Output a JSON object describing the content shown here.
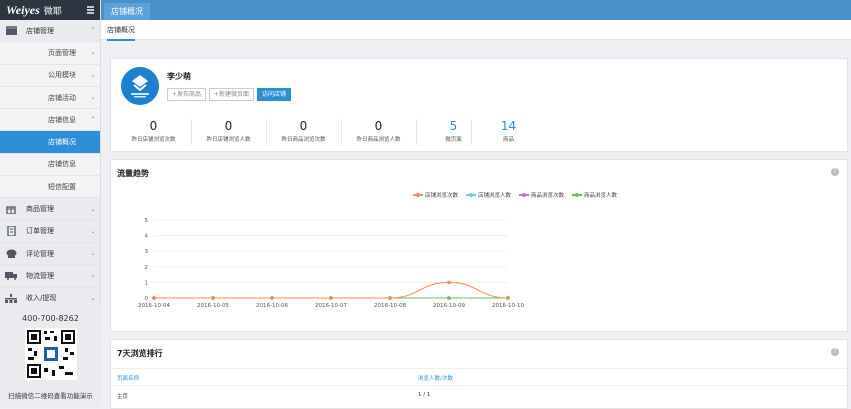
{
  "brand": {
    "logo_text": "Weiyes",
    "name_cn": "微耶"
  },
  "sidebar": {
    "items": [
      {
        "label": "店铺管理",
        "level": "top",
        "chev": "^",
        "icon": "store-icon"
      },
      {
        "label": "页面管理",
        "level": "sub",
        "chev": "v"
      },
      {
        "label": "公用模块",
        "level": "sub",
        "chev": "v"
      },
      {
        "label": "店铺活动",
        "level": "sub",
        "chev": "v"
      },
      {
        "label": "店铺信息",
        "level": "sub",
        "chev": "^"
      },
      {
        "label": "店铺概况",
        "level": "leaf",
        "active": true
      },
      {
        "label": "店铺信息",
        "level": "leaf"
      },
      {
        "label": "短信配置",
        "level": "leaf"
      },
      {
        "label": "商品管理",
        "level": "top",
        "chev": "v",
        "icon": "gift-icon"
      },
      {
        "label": "订单管理",
        "level": "top",
        "chev": "v",
        "icon": "order-icon"
      },
      {
        "label": "评论管理",
        "level": "top",
        "chev": "v",
        "icon": "comment-icon"
      },
      {
        "label": "物流管理",
        "level": "top",
        "chev": "v",
        "icon": "truck-icon"
      },
      {
        "label": "收入/提现",
        "level": "top",
        "chev": "v",
        "icon": "income-icon"
      }
    ],
    "phone": "400-700-8262",
    "qr_caption": "扫描微信二维码查看功能演示"
  },
  "topbar": {
    "title": "店铺概况"
  },
  "subnav": {
    "tab": "店铺概况"
  },
  "shop": {
    "name": "李少萌",
    "buttons": {
      "publish": "+发布商品",
      "new_page": "+新建微页面",
      "visit": "访问店铺"
    },
    "stats": [
      {
        "value": "0",
        "label": "昨日店铺浏览次数"
      },
      {
        "value": "0",
        "label": "昨日店铺浏览人数"
      },
      {
        "value": "0",
        "label": "昨日商品浏览次数"
      },
      {
        "value": "0",
        "label": "昨日商品浏览人数"
      },
      {
        "value": "5",
        "label": "微页面"
      },
      {
        "value": "14",
        "label": "商品"
      }
    ]
  },
  "trend": {
    "title": "流量趋势",
    "help": "?",
    "legend": [
      "店铺浏览次数",
      "店铺浏览人数",
      "商品浏览次数",
      "商品浏览人数"
    ]
  },
  "chart_data": {
    "type": "line",
    "x": [
      "2016-10-04",
      "2016-10-05",
      "2016-10-06",
      "2016-10-07",
      "2016-10-08",
      "2016-10-09",
      "2016-10-10"
    ],
    "ylim": [
      0,
      5
    ],
    "yticks": [
      "0",
      "1",
      "2",
      "3",
      "4",
      "5"
    ],
    "grid": true,
    "legend_position": "top",
    "series": [
      {
        "name": "店铺浏览次数",
        "color": "#f08c5a",
        "values": [
          0,
          0,
          0,
          0,
          0,
          1,
          0
        ]
      },
      {
        "name": "店铺浏览人数",
        "color": "#7ec6d8",
        "values": [
          0,
          0,
          0,
          0,
          0,
          0,
          0
        ]
      },
      {
        "name": "商品浏览次数",
        "color": "#b57ad6",
        "values": [
          0,
          0,
          0,
          0,
          0,
          0,
          0
        ]
      },
      {
        "name": "商品浏览人数",
        "color": "#6cbf5c",
        "values": [
          0,
          0,
          0,
          0,
          0,
          0,
          0
        ]
      }
    ]
  },
  "rank": {
    "title": "7天浏览排行",
    "help": "?",
    "col_page": "页面名称",
    "col_views": "浏览人数/次数",
    "rows": [
      {
        "page": "主页",
        "views": "1 / 1"
      }
    ]
  },
  "colors": {
    "accent": "#2f8fd6",
    "topbar": "#4a90c9",
    "sidebar_header": "#2d3640"
  }
}
